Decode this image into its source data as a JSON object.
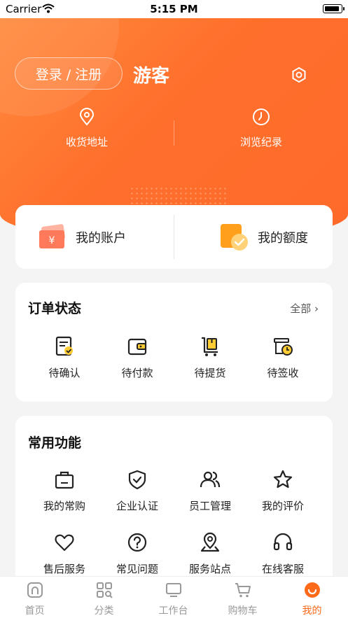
{
  "status_bar": {
    "carrier": "Carrier",
    "time": "5:15 PM",
    "battery_level": 0.9
  },
  "header": {
    "login_label": "登录 / 注册",
    "username": "游客",
    "nav": [
      {
        "label": "收货地址",
        "icon": "location-pin-icon"
      },
      {
        "label": "浏览纪录",
        "icon": "clock-icon"
      }
    ]
  },
  "account": {
    "items": [
      {
        "label": "我的账户",
        "icon": "wallet-card-icon"
      },
      {
        "label": "我的额度",
        "icon": "credit-quota-icon"
      }
    ]
  },
  "orders": {
    "title": "订单状态",
    "more": "全部",
    "items": [
      {
        "label": "待确认",
        "icon": "pending-confirm-icon"
      },
      {
        "label": "待付款",
        "icon": "wallet-icon"
      },
      {
        "label": "待提货",
        "icon": "pickup-cart-icon"
      },
      {
        "label": "待签收",
        "icon": "sign-receipt-icon"
      }
    ]
  },
  "functions": {
    "title": "常用功能",
    "items": [
      {
        "label": "我的常购",
        "icon": "shopping-bag-icon"
      },
      {
        "label": "企业认证",
        "icon": "shield-check-icon"
      },
      {
        "label": "员工管理",
        "icon": "users-icon"
      },
      {
        "label": "我的评价",
        "icon": "star-icon"
      },
      {
        "label": "售后服务",
        "icon": "heart-icon"
      },
      {
        "label": "常见问题",
        "icon": "question-icon"
      },
      {
        "label": "服务站点",
        "icon": "map-pin-icon"
      },
      {
        "label": "在线客服",
        "icon": "headset-icon"
      }
    ]
  },
  "tabbar": {
    "items": [
      {
        "label": "首页",
        "icon": "home-icon"
      },
      {
        "label": "分类",
        "icon": "category-icon"
      },
      {
        "label": "工作台",
        "icon": "monitor-icon"
      },
      {
        "label": "购物车",
        "icon": "cart-icon"
      },
      {
        "label": "我的",
        "icon": "profile-icon",
        "active": true
      }
    ]
  },
  "colors": {
    "accent": "#ff6a1a",
    "header_start": "#ff8a3d",
    "header_end": "#ff6a2a",
    "icon_yellow": "#ffcc33"
  }
}
